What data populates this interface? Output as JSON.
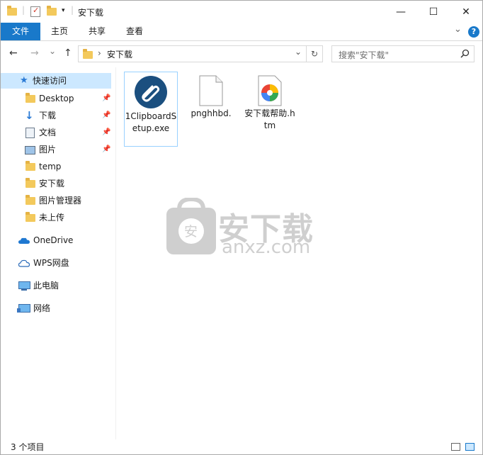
{
  "titlebar": {
    "title": "安下载",
    "minimize": "—",
    "maximize": "☐",
    "close": "✕"
  },
  "ribbon": {
    "tabs": [
      "文件",
      "主页",
      "共享",
      "查看"
    ],
    "expand": "⌄",
    "help": "?"
  },
  "nav": {
    "back": "←",
    "forward": "→",
    "recent": "⌄",
    "up": "↑",
    "refresh": "↻"
  },
  "address": {
    "chevron": "›",
    "path": "安下载",
    "dropdown": "⌄"
  },
  "search": {
    "placeholder": "搜索\"安下载\"",
    "icon": "search-icon"
  },
  "navpane": {
    "quick_access": "快速访问",
    "items": [
      {
        "label": "Desktop",
        "icon": "folder-icon",
        "pinned": true
      },
      {
        "label": "下载",
        "icon": "download-icon",
        "pinned": true
      },
      {
        "label": "文档",
        "icon": "document-icon",
        "pinned": true
      },
      {
        "label": "图片",
        "icon": "picture-icon",
        "pinned": true
      },
      {
        "label": "temp",
        "icon": "folder-icon",
        "pinned": false
      },
      {
        "label": "安下载",
        "icon": "folder-icon",
        "pinned": false
      },
      {
        "label": "图片管理器",
        "icon": "folder-icon",
        "pinned": false
      },
      {
        "label": "未上传",
        "icon": "folder-icon",
        "pinned": false
      }
    ],
    "onedrive": "OneDrive",
    "wps": "WPS网盘",
    "thispc": "此电脑",
    "network": "网络"
  },
  "files": [
    {
      "name": "1ClipboardSetup.exe",
      "icon": "clipboard-app-icon"
    },
    {
      "name": "pnghhbd.",
      "icon": "blank-file-icon"
    },
    {
      "name": "安下载帮助.htm",
      "icon": "htm-file-icon"
    }
  ],
  "watermark": {
    "cn": "安下载",
    "en": "anxz.com",
    "badge": "安"
  },
  "status": {
    "count": "3 个项目"
  },
  "colors": {
    "accent": "#1979ca",
    "selection": "#cce8ff",
    "folder": "#f3c95c"
  }
}
